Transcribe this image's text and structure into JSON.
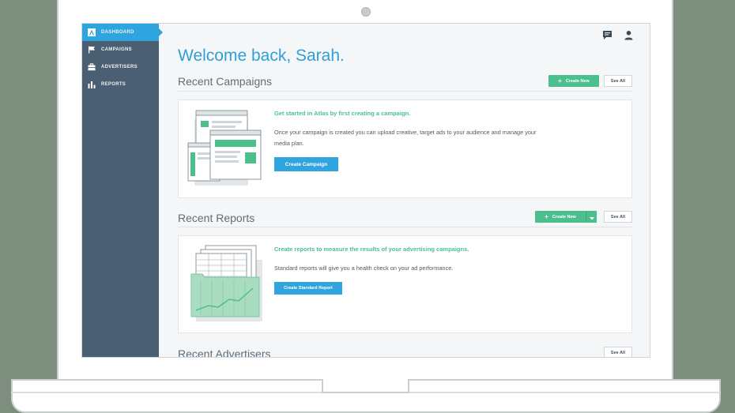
{
  "sidebar": {
    "items": [
      {
        "label": "DASHBOARD",
        "icon": "atlas-logo-icon",
        "active": true
      },
      {
        "label": "CAMPAIGNS",
        "icon": "flag-icon",
        "active": false
      },
      {
        "label": "ADVERTISERS",
        "icon": "briefcase-icon",
        "active": false
      },
      {
        "label": "REPORTS",
        "icon": "bar-chart-icon",
        "active": false
      }
    ]
  },
  "header": {
    "welcome": "Welcome back, Sarah.",
    "icons": [
      "chat-icon",
      "user-icon"
    ]
  },
  "campaigns": {
    "title": "Recent Campaigns",
    "create_label": "Create New",
    "see_all_label": "See All",
    "card": {
      "heading": "Get started in Atlas by first creating a campaign.",
      "text": "Once your campaign is created you can upload creative, target ads to your audience and manage your media plan.",
      "button": "Create Campaign"
    }
  },
  "reports": {
    "title": "Recent Reports",
    "create_label": "Create New",
    "see_all_label": "See All",
    "card": {
      "heading": "Create reports to measure the results of your advertising campaigns.",
      "text": "Standard reports will give you a health check on your ad performance.",
      "button": "Create Standard Report"
    }
  },
  "advertisers": {
    "title": "Recent Advertisers",
    "see_all_label": "See All"
  },
  "colors": {
    "accent_blue": "#2fa4de",
    "accent_green": "#4bbf8c",
    "sidebar": "#4a5f71"
  }
}
